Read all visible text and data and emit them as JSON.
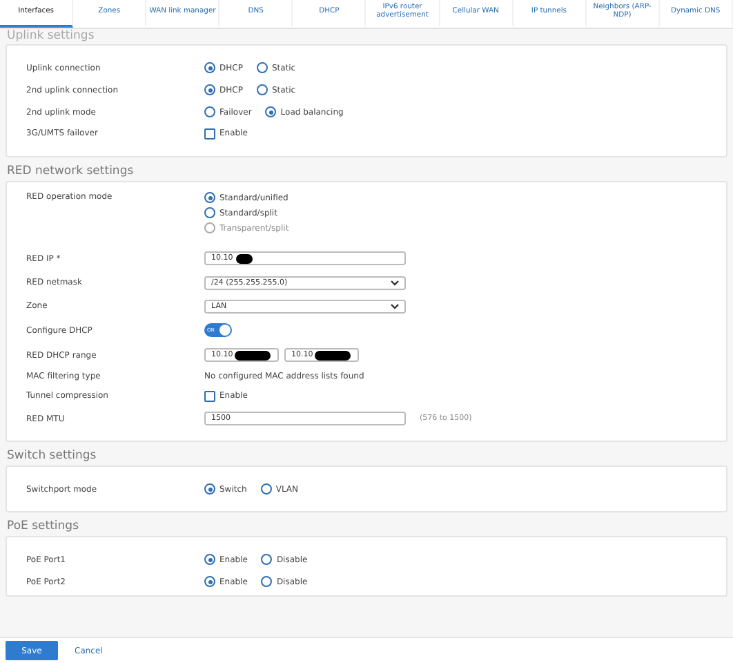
{
  "tabs": [
    {
      "label": "Interfaces",
      "selected": true
    },
    {
      "label": "Zones",
      "selected": false
    },
    {
      "label": "WAN link manager",
      "selected": false
    },
    {
      "label": "DNS",
      "selected": false
    },
    {
      "label": "DHCP",
      "selected": false
    },
    {
      "label": "IPv6 router advertisement",
      "selected": false
    },
    {
      "label": "Cellular WAN",
      "selected": false
    },
    {
      "label": "IP tunnels",
      "selected": false
    },
    {
      "label": "Neighbors (ARP-NDP)",
      "selected": false
    },
    {
      "label": "Dynamic DNS",
      "selected": false
    }
  ],
  "sections": [
    {
      "title": "Uplink settings",
      "faded": true,
      "rows": [
        {
          "kind": "radio",
          "label": "Uplink connection",
          "options": [
            {
              "label": "DHCP",
              "selected": true,
              "disabled": false
            },
            {
              "label": "Static",
              "selected": false,
              "disabled": false
            }
          ]
        },
        {
          "kind": "radio",
          "label": "2nd uplink connection",
          "options": [
            {
              "label": "DHCP",
              "selected": true,
              "disabled": false
            },
            {
              "label": "Static",
              "selected": false,
              "disabled": false
            }
          ]
        },
        {
          "kind": "radio",
          "label": "2nd uplink mode",
          "options": [
            {
              "label": "Failover",
              "selected": false,
              "disabled": false
            },
            {
              "label": "Load balancing",
              "selected": true,
              "disabled": false
            }
          ]
        },
        {
          "kind": "checkbox",
          "label": "3G/UMTS failover",
          "option": "Enable",
          "checked": false
        }
      ]
    },
    {
      "title": "RED network settings",
      "faded": false,
      "rows": [
        {
          "kind": "radio-stack",
          "label": "RED operation mode",
          "options": [
            {
              "label": "Standard/unified",
              "selected": true,
              "disabled": false
            },
            {
              "label": "Standard/split",
              "selected": false,
              "disabled": false
            },
            {
              "label": "Transparent/split",
              "selected": false,
              "disabled": true
            }
          ]
        },
        {
          "kind": "input",
          "label": "RED IP *",
          "value": "10.10",
          "redacted": true
        },
        {
          "kind": "select",
          "label": "RED netmask",
          "value": "/24 (255.255.255.0)"
        },
        {
          "kind": "select",
          "label": "Zone",
          "value": "LAN"
        },
        {
          "kind": "toggle",
          "label": "Configure DHCP",
          "on": true,
          "state_text": "ON"
        },
        {
          "kind": "range",
          "label": "RED DHCP range",
          "from": "10.10",
          "to": "10.10",
          "redacted": true
        },
        {
          "kind": "text",
          "label": "MAC filtering type",
          "value": "No configured MAC address lists found"
        },
        {
          "kind": "checkbox",
          "label": "Tunnel compression",
          "option": "Enable",
          "checked": false
        },
        {
          "kind": "input",
          "label": "RED MTU",
          "value": "1500",
          "hint": "(576 to 1500)"
        }
      ]
    },
    {
      "title": "Switch settings",
      "faded": false,
      "rows": [
        {
          "kind": "radio",
          "label": "Switchport mode",
          "options": [
            {
              "label": "Switch",
              "selected": true,
              "disabled": false
            },
            {
              "label": "VLAN",
              "selected": false,
              "disabled": false
            }
          ]
        }
      ]
    },
    {
      "title": "PoE settings",
      "faded": false,
      "rows": [
        {
          "kind": "radio",
          "label": "PoE Port1",
          "options": [
            {
              "label": "Enable",
              "selected": true,
              "disabled": false
            },
            {
              "label": "Disable",
              "selected": false,
              "disabled": false
            }
          ]
        },
        {
          "kind": "radio",
          "label": "PoE Port2",
          "options": [
            {
              "label": "Enable",
              "selected": true,
              "disabled": false
            },
            {
              "label": "Disable",
              "selected": false,
              "disabled": false
            }
          ]
        }
      ]
    }
  ],
  "footer": {
    "save": "Save",
    "cancel": "Cancel"
  }
}
